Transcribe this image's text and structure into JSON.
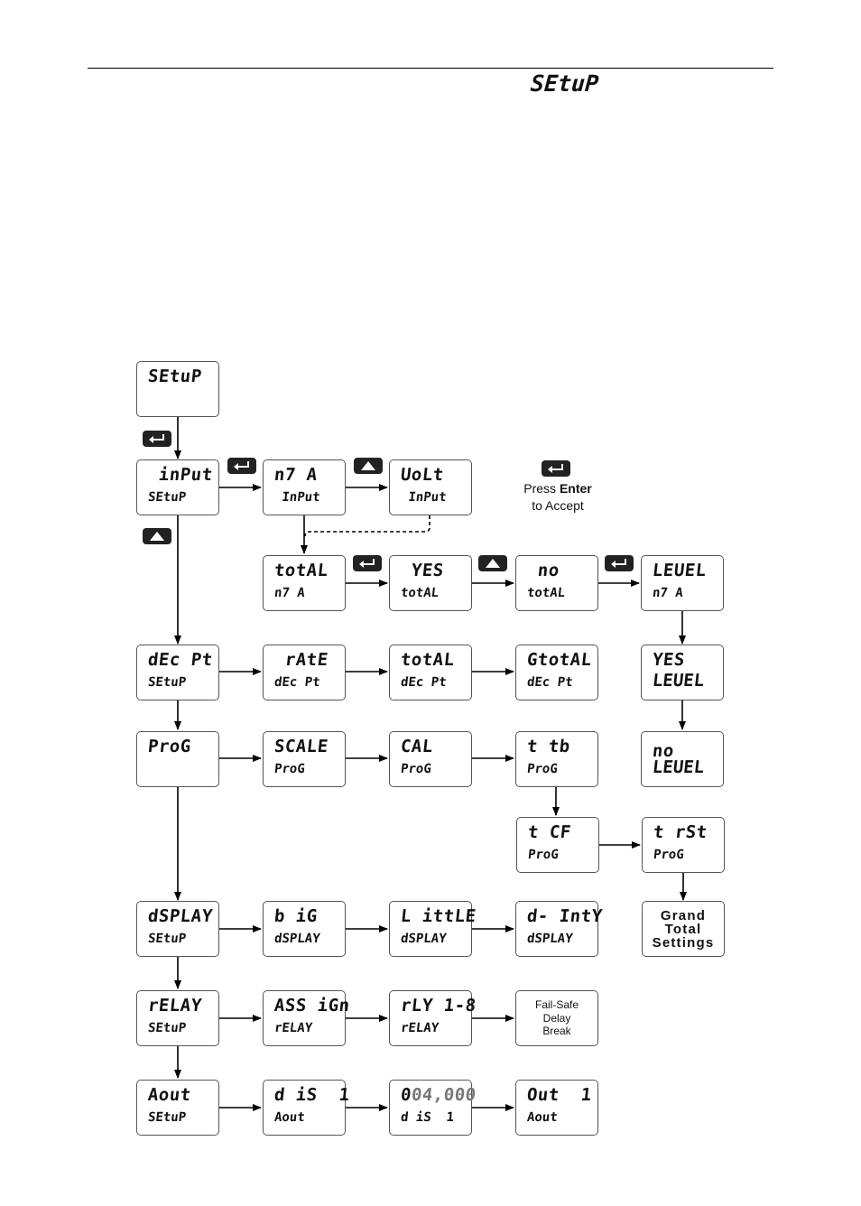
{
  "header": {
    "title": "SEtuP"
  },
  "legend": {
    "line1_prefix": "Press ",
    "line1_bold": "Enter",
    "line2": "to Accept",
    "key_icon": "enter-key-icon"
  },
  "boxes": {
    "setup": {
      "l1": "SEtuP",
      "l2": ""
    },
    "input": {
      "l1": " inPut",
      "l2": "SEtuP"
    },
    "ma": {
      "l1": "n7 A",
      "l2": " InPut"
    },
    "volt": {
      "l1": "UoLt",
      "l2": " InPut"
    },
    "total": {
      "l1": "totAL",
      "l2": "n7 A"
    },
    "yes_total": {
      "l1": " YES",
      "l2": "totAL"
    },
    "no_total": {
      "l1": " no",
      "l2": "totAL"
    },
    "level": {
      "l1": "LEUEL",
      "l2": "n7 A"
    },
    "yes_level": {
      "l1": "YES",
      "l2": "LEUEL"
    },
    "no_level": {
      "l1": "no",
      "l2": "LEUEL"
    },
    "dec_pt": {
      "l1": "dEc Pt",
      "l2": "SEtuP"
    },
    "rate": {
      "l1": " rAtE",
      "l2": "dEc Pt"
    },
    "total_dec": {
      "l1": "totAL",
      "l2": "dEc Pt"
    },
    "gtotal_dec": {
      "l1": "GtotAL",
      "l2": "dEc Pt"
    },
    "prog": {
      "l1": "ProG",
      "l2": ""
    },
    "scale": {
      "l1": "SCALE",
      "l2": "ProG"
    },
    "cal": {
      "l1": "CAL",
      "l2": "ProG"
    },
    "t_tb": {
      "l1": "t tb",
      "l2": "ProG"
    },
    "t_cf": {
      "l1": "t CF",
      "l2": "ProG"
    },
    "t_rst": {
      "l1": "t rSt",
      "l2": "ProG"
    },
    "grand_total": {
      "l1": "Grand",
      "l2": "Total",
      "l3": "Settings"
    },
    "dsplay": {
      "l1": "dSPLAY",
      "l2": "SEtuP"
    },
    "big": {
      "l1": "b iG",
      "l2": "dSPLAY"
    },
    "little": {
      "l1": "L ittLE",
      "l2": "dSPLAY"
    },
    "d_inty": {
      "l1": "d- IntY",
      "l2": "dSPLAY"
    },
    "relay": {
      "l1": "rELAY",
      "l2": "SEtuP"
    },
    "assign": {
      "l1": "ASS iGn",
      "l2": "rELAY"
    },
    "rly": {
      "l1": "rLY 1-8",
      "l2": "rELAY"
    },
    "failsafe": {
      "l1": "Fail-Safe",
      "l2": "Delay",
      "l3": "Break"
    },
    "aout": {
      "l1": "Aout",
      "l2": "SEtuP"
    },
    "dis1": {
      "l1": "d iS  1",
      "l2": "Aout"
    },
    "value": {
      "l1_lead": "0",
      "l1_rest": "04,000",
      "l2": "d iS  1"
    },
    "out1": {
      "l1": "Out  1",
      "l2": "Aout"
    }
  },
  "keys": {
    "enter": "enter-key",
    "up": "up-key"
  }
}
